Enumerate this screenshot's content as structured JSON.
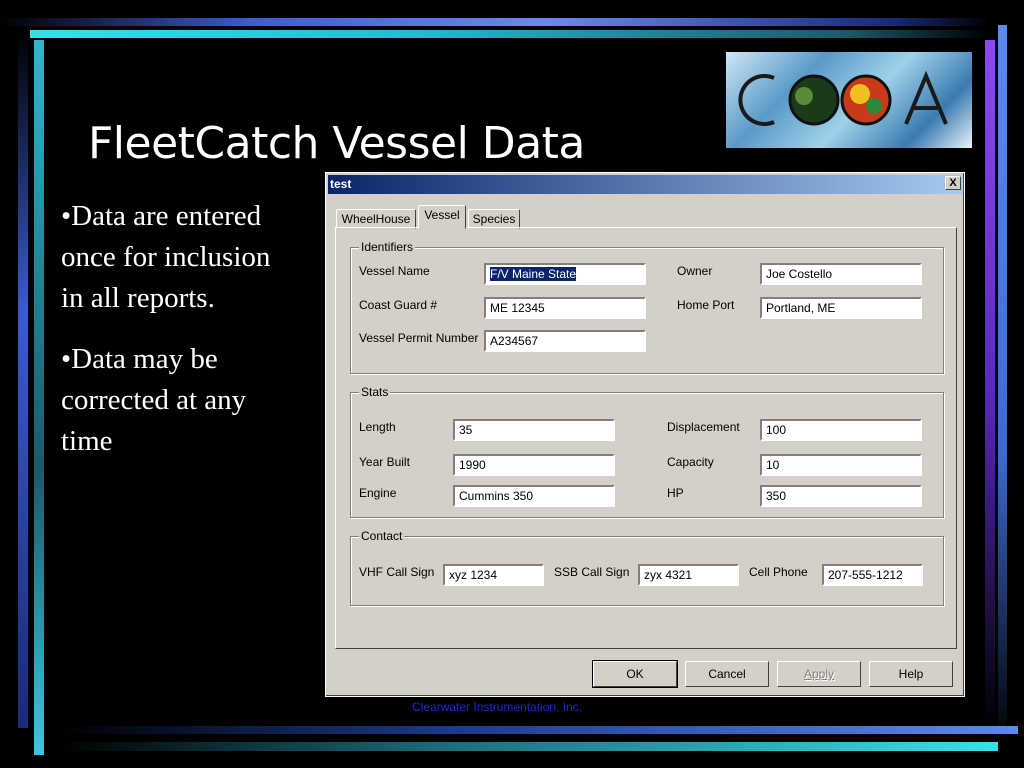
{
  "slide": {
    "title": "FleetCatch Vessel Data",
    "bullets": [
      "•Data are entered once for inclusion in all reports.",
      "•Data may be corrected at any time"
    ],
    "footer": "Clearwater Instrumentation, Inc.",
    "logo_text": "COOA"
  },
  "dialog": {
    "title": "test",
    "close_label": "X",
    "tabs": [
      {
        "label": "WheelHouse",
        "active": false
      },
      {
        "label": "Vessel",
        "active": true
      },
      {
        "label": "Species",
        "active": false
      }
    ],
    "identifiers": {
      "group_label": "Identifiers",
      "vessel_name_label": "Vessel Name",
      "vessel_name": "F/V Maine State",
      "owner_label": "Owner",
      "owner": "Joe Costello",
      "coast_guard_label": "Coast Guard #",
      "coast_guard": "ME 12345",
      "home_port_label": "Home Port",
      "home_port": "Portland, ME",
      "permit_label": "Vessel Permit Number",
      "permit": "A234567"
    },
    "stats": {
      "group_label": "Stats",
      "length_label": "Length",
      "length": "35",
      "displacement_label": "Displacement",
      "displacement": "100",
      "year_built_label": "Year Built",
      "year_built": "1990",
      "capacity_label": "Capacity",
      "capacity": "10",
      "engine_label": "Engine",
      "engine": "Cummins 350",
      "hp_label": "HP",
      "hp": "350"
    },
    "contact": {
      "group_label": "Contact",
      "vhf_label": "VHF Call Sign",
      "vhf": "xyz 1234",
      "ssb_label": "SSB Call Sign",
      "ssb": "zyx 4321",
      "cell_label": "Cell Phone",
      "cell": "207-555-1212"
    },
    "buttons": {
      "ok": "OK",
      "cancel": "Cancel",
      "apply": "Apply",
      "help": "Help"
    }
  },
  "colors": {
    "dialog_face": "#d4d0c8",
    "titlebar_start": "#0a246a",
    "titlebar_end": "#a6caf0",
    "footer_text": "#1a2ad0"
  }
}
